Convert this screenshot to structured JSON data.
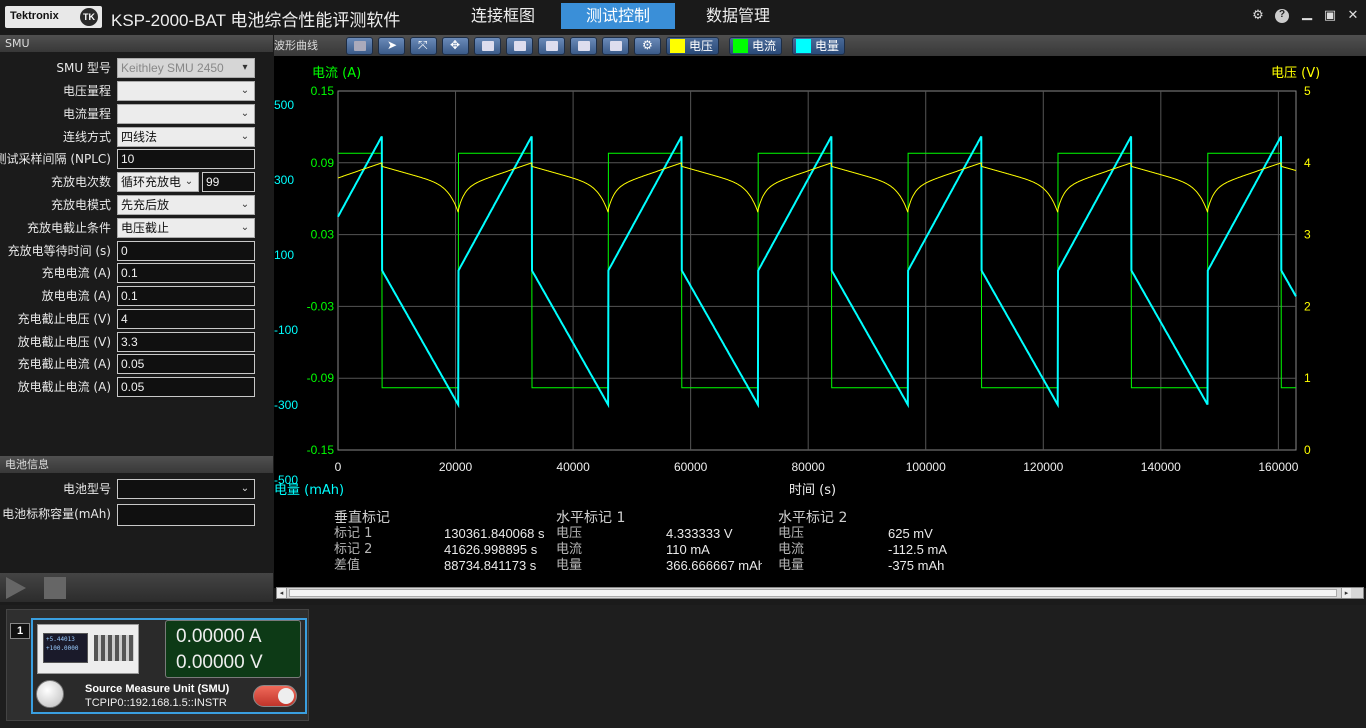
{
  "app": {
    "logo": "Tektronix",
    "title": "KSP-2000-BAT 电池综合性能评测软件"
  },
  "nav": {
    "tabs": [
      {
        "label": "连接框图"
      },
      {
        "label": "测试控制"
      },
      {
        "label": "数据管理"
      }
    ],
    "active_tab": "测试控制"
  },
  "smu_panel": {
    "title": "SMU",
    "rows": [
      {
        "label": "SMU 型号",
        "value": "Keithley SMU 2450"
      },
      {
        "label": "电压量程",
        "value": ""
      },
      {
        "label": "电流量程",
        "value": ""
      },
      {
        "label": "连线方式",
        "value": "四线法"
      },
      {
        "label": "测试采样间隔 (NPLC)",
        "value": "10"
      },
      {
        "label": "充放电次数",
        "value": "循环充放电",
        "value2": "99"
      },
      {
        "label": "充放电模式",
        "value": "先充后放"
      },
      {
        "label": "充放电截止条件",
        "value": "电压截止"
      },
      {
        "label": "充放电等待时间 (s)",
        "value": "0"
      },
      {
        "label": "充电电流 (A)",
        "value": "0.1"
      },
      {
        "label": "放电电流 (A)",
        "value": "0.1"
      },
      {
        "label": "充电截止电压 (V)",
        "value": "4"
      },
      {
        "label": "放电截止电压 (V)",
        "value": "3.3"
      },
      {
        "label": "充电截止电流 (A)",
        "value": "0.05"
      },
      {
        "label": "放电截止电流 (A)",
        "value": "0.05"
      }
    ]
  },
  "battery_panel": {
    "title": "电池信息",
    "rows": [
      {
        "label": "电池型号",
        "value": ""
      },
      {
        "label": "电池标称容量(mAh)",
        "value": ""
      }
    ]
  },
  "waveform_panel": {
    "title": "波形曲线",
    "legend": [
      {
        "label": "电压",
        "color": "#ffff00"
      },
      {
        "label": "电流",
        "color": "#00ff00"
      },
      {
        "label": "电量",
        "color": "#00ffff"
      }
    ]
  },
  "chart_data": {
    "type": "line",
    "xlabel": "时间 (s)",
    "y_left_label": "电流 (A)",
    "y_right_label": "电压 (V)",
    "y_cap_label": "电量 (mAh)",
    "x_ticks": [
      "0",
      "20000",
      "40000",
      "60000",
      "80000",
      "100000",
      "120000",
      "140000",
      "160000"
    ],
    "current_ticks": [
      "0.15",
      "0.09",
      "0.03",
      "-0.03",
      "-0.09",
      "-0.15"
    ],
    "voltage_ticks": [
      "5",
      "4",
      "3",
      "2",
      "1",
      "0"
    ],
    "capacity_ticks": [
      "500",
      "300",
      "100",
      "-100",
      "-300",
      "-500"
    ],
    "xlim": [
      0,
      163000
    ],
    "current_ylim": [
      -0.15,
      0.15
    ],
    "voltage_ylim": [
      0,
      5
    ],
    "capacity_ylim": [
      -500,
      500
    ],
    "cycle_period_s": 25500,
    "charge_duration_s": 12500,
    "current_charge_A": 0.1,
    "current_discharge_A": -0.1,
    "voltage_range_V": [
      3.3,
      4.0
    ],
    "capacity_range_mAh": [
      -375,
      375
    ],
    "series": [
      {
        "name": "电压",
        "color": "#ffff00"
      },
      {
        "name": "电流",
        "color": "#00ff00"
      },
      {
        "name": "电量",
        "color": "#00ffff"
      }
    ]
  },
  "markers": {
    "vertical": {
      "title": "垂直标记",
      "rows": [
        {
          "label": "标记 1",
          "value": "130361.840068 s"
        },
        {
          "label": "标记 2",
          "value": "41626.998895 s"
        },
        {
          "label": "差值",
          "value": "88734.841173 s"
        }
      ]
    },
    "horizontal1": {
      "title": "水平标记 1",
      "rows": [
        {
          "label": "电压",
          "value": "4.333333 V"
        },
        {
          "label": "电流",
          "value": "110 mA"
        },
        {
          "label": "电量",
          "value": "366.666667 mAh"
        }
      ]
    },
    "horizontal2": {
      "title": "水平标记 2",
      "rows": [
        {
          "label": "电压",
          "value": "625 mV"
        },
        {
          "label": "电流",
          "value": "-112.5 mA"
        },
        {
          "label": "电量",
          "value": "-375 mAh"
        }
      ]
    }
  },
  "device": {
    "slot": "1",
    "current_reading": "0.00000 A",
    "voltage_reading": "0.00000 V",
    "name": "Source Measure Unit (SMU)",
    "address": "TCPIP0::192.168.1.5::INSTR",
    "screen_line1": "+5.44013",
    "screen_line2": "+100.0000"
  },
  "colors": {
    "accent": "#3a8fd8",
    "voltage": "#ffff00",
    "current": "#00ff00",
    "capacity": "#00ffff"
  }
}
